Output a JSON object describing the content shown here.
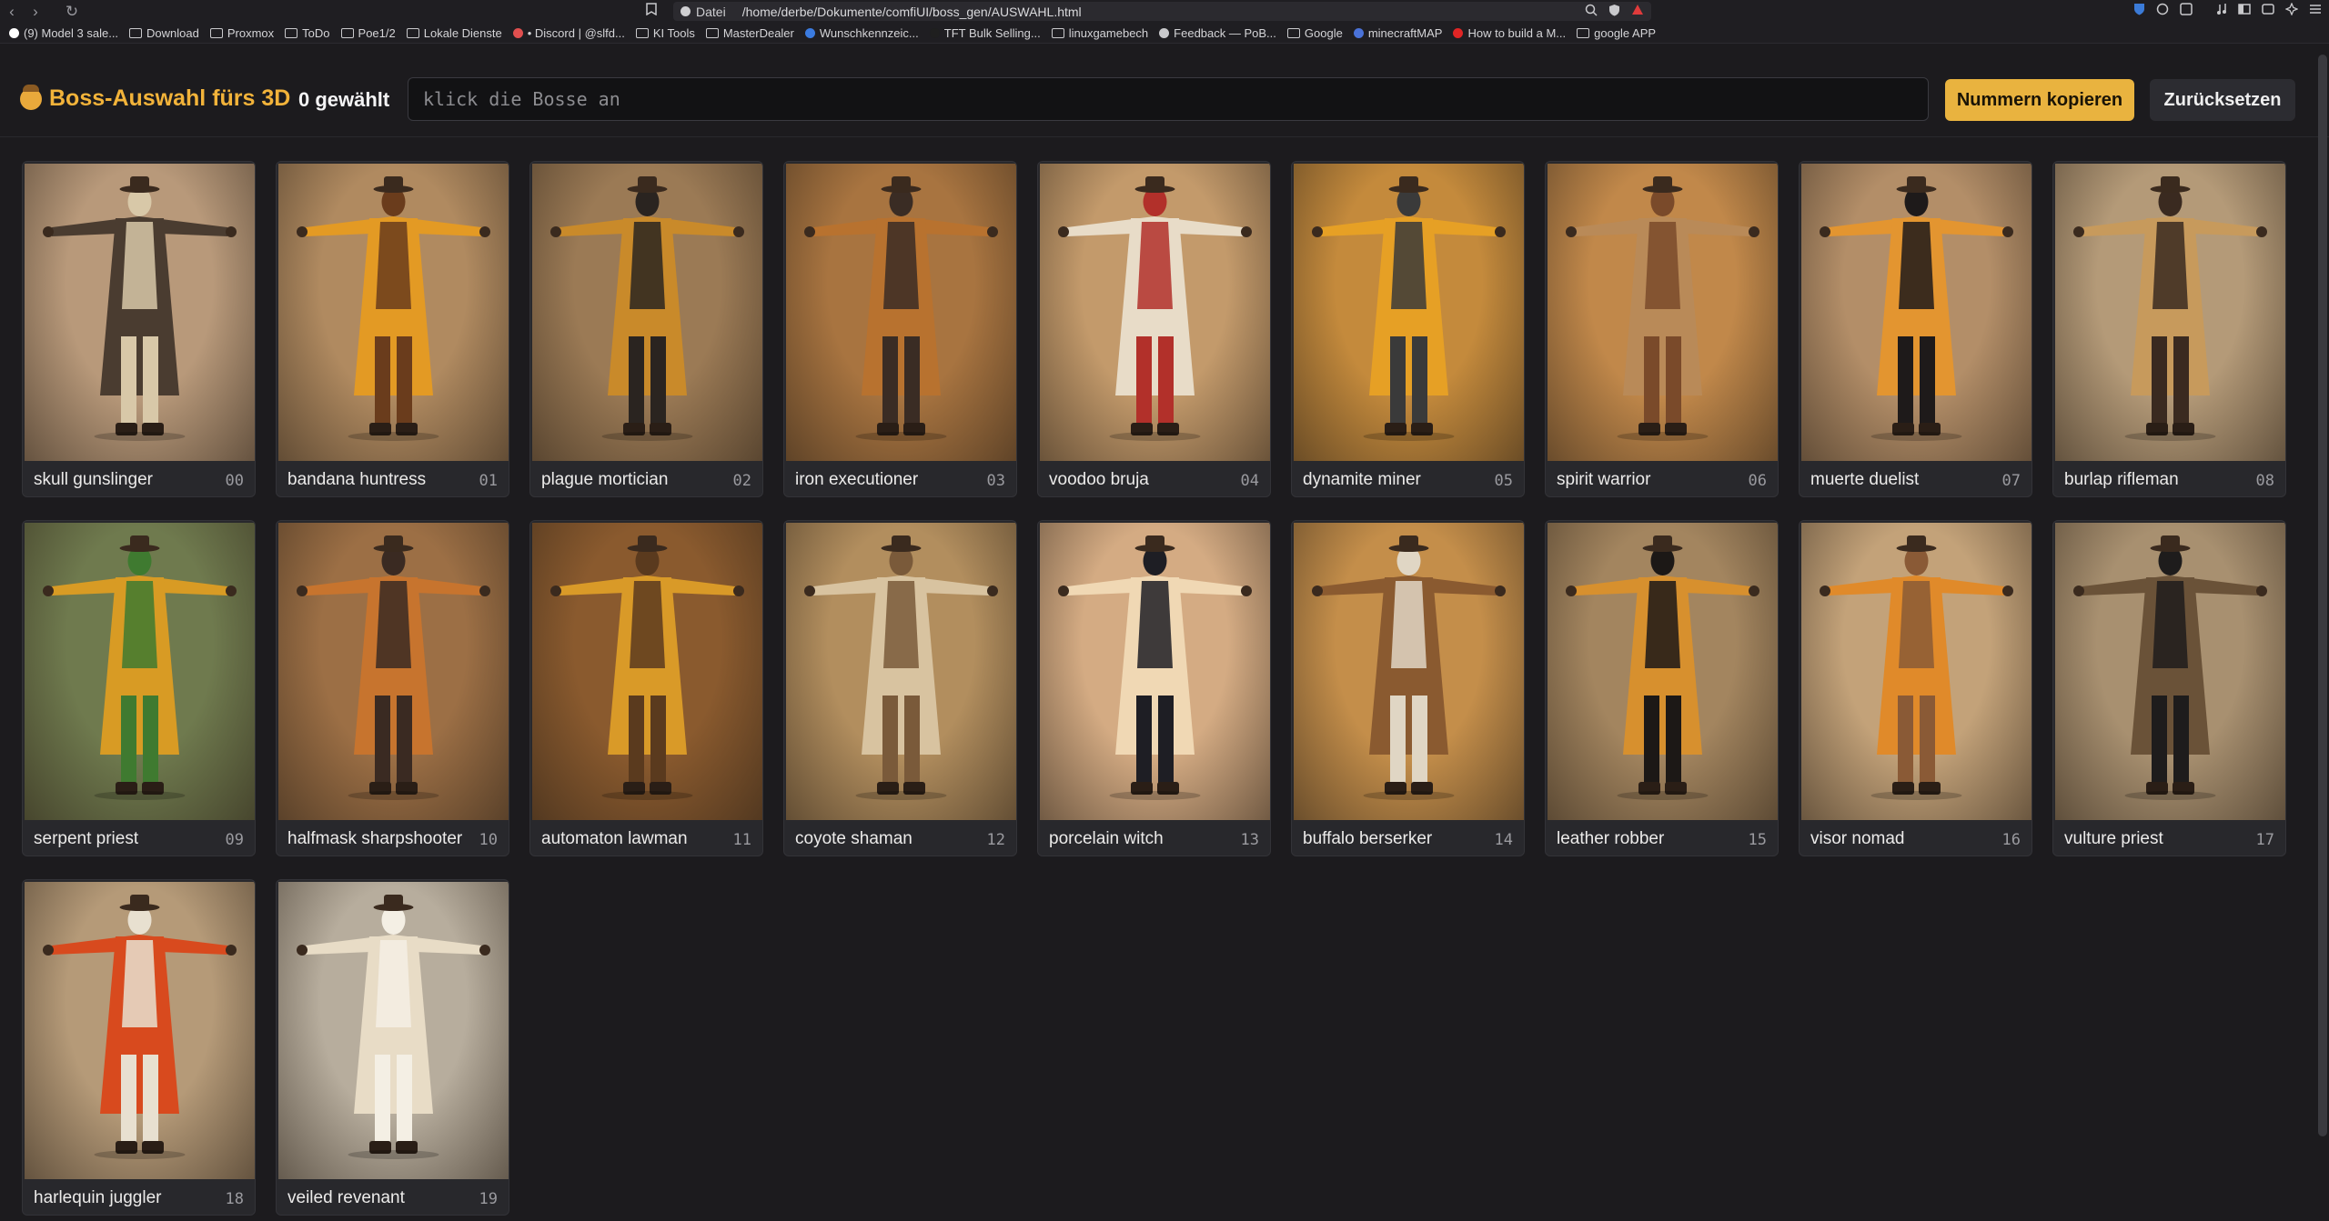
{
  "browser": {
    "nav": {
      "back": "‹",
      "forward": "›",
      "reload": "↻"
    },
    "url_scheme": "Datei",
    "url_path": "/home/derbe/Dokumente/comfiUI/boss_gen/AUSWAHL.html",
    "bookmarks": [
      {
        "label": "(9) Model 3 sale...",
        "icon": "x-logo-icon",
        "color": "#ffffff"
      },
      {
        "label": "Download",
        "icon": "folder-icon"
      },
      {
        "label": "Proxmox",
        "icon": "folder-icon"
      },
      {
        "label": "ToDo",
        "icon": "folder-icon"
      },
      {
        "label": "Poe1/2",
        "icon": "folder-icon"
      },
      {
        "label": "Lokale Dienste",
        "icon": "folder-icon"
      },
      {
        "label": "• Discord | @slfd...",
        "icon": "discord-icon",
        "color": "#e04f4f"
      },
      {
        "label": "KI Tools",
        "icon": "folder-icon"
      },
      {
        "label": "MasterDealer",
        "icon": "folder-icon"
      },
      {
        "label": "Wunschkennzeic...",
        "icon": "site-icon",
        "color": "#3b7be0"
      },
      {
        "label": "TFT Bulk Selling...",
        "icon": "site-icon",
        "color": "#1f1f1f"
      },
      {
        "label": "linuxgamebech",
        "icon": "folder-icon"
      },
      {
        "label": "Feedback — PoB...",
        "icon": "globe-icon",
        "color": "#c9c9cc"
      },
      {
        "label": "Google",
        "icon": "folder-icon"
      },
      {
        "label": "minecraftMAP",
        "icon": "site-icon",
        "color": "#4a72d8"
      },
      {
        "label": "How to build a M...",
        "icon": "youtube-icon",
        "color": "#e02525"
      },
      {
        "label": "google APP",
        "icon": "folder-icon"
      }
    ]
  },
  "app": {
    "title": "Boss-Auswahl fürs 3D",
    "count_label": "0 gewählt",
    "search_placeholder": "klick die Bosse an",
    "copy_label": "Nummern kopieren",
    "reset_label": "Zurücksetzen",
    "accent": "#e9b33f"
  },
  "bosses": [
    {
      "name": "skull gunslinger",
      "num": "00",
      "bg": "#b8997a",
      "coat": "#4a3c30",
      "accent": "#d8c8a8"
    },
    {
      "name": "bandana huntress",
      "num": "01",
      "bg": "#b08a60",
      "coat": "#e39a24",
      "accent": "#6a3c1c"
    },
    {
      "name": "plague mortician",
      "num": "02",
      "bg": "#9b7a55",
      "coat": "#c98a2a",
      "accent": "#2a2420"
    },
    {
      "name": "iron executioner",
      "num": "03",
      "bg": "#a87440",
      "coat": "#b8722f",
      "accent": "#3a2c24"
    },
    {
      "name": "voodoo bruja",
      "num": "04",
      "bg": "#c39a6b",
      "coat": "#e8dcc8",
      "accent": "#b2302a"
    },
    {
      "name": "dynamite miner",
      "num": "05",
      "bg": "#c48a3c",
      "coat": "#e6a025",
      "accent": "#3a3a3a"
    },
    {
      "name": "spirit warrior",
      "num": "06",
      "bg": "#c1884a",
      "coat": "#b98a58",
      "accent": "#7a4a2a"
    },
    {
      "name": "muerte duelist",
      "num": "07",
      "bg": "#b38e68",
      "coat": "#e39530",
      "accent": "#1e1a1a"
    },
    {
      "name": "burlap rifleman",
      "num": "08",
      "bg": "#b49a78",
      "coat": "#c79a5c",
      "accent": "#3a2a20"
    },
    {
      "name": "serpent priest",
      "num": "09",
      "bg": "#6f7a4e",
      "coat": "#d89b24",
      "accent": "#3f7a30"
    },
    {
      "name": "halfmask sharpshooter",
      "num": "10",
      "bg": "#9c6f45",
      "coat": "#c7742e",
      "accent": "#3a2a22"
    },
    {
      "name": "automaton lawman",
      "num": "11",
      "bg": "#8a5a2e",
      "coat": "#d99a28",
      "accent": "#5a3a1e"
    },
    {
      "name": "coyote shaman",
      "num": "12",
      "bg": "#b28e5e",
      "coat": "#d8c3a0",
      "accent": "#7a5a3a"
    },
    {
      "name": "porcelain witch",
      "num": "13",
      "bg": "#d4ab83",
      "coat": "#f0d8b4",
      "accent": "#1e1e24"
    },
    {
      "name": "buffalo berserker",
      "num": "14",
      "bg": "#c48e4a",
      "coat": "#8a5a30",
      "accent": "#e0d6c4"
    },
    {
      "name": "leather robber",
      "num": "15",
      "bg": "#a3855f",
      "coat": "#d7902e",
      "accent": "#1c1816"
    },
    {
      "name": "visor nomad",
      "num": "16",
      "bg": "#c3a279",
      "coat": "#e08a2a",
      "accent": "#8a5a36"
    },
    {
      "name": "vulture priest",
      "num": "17",
      "bg": "#a89070",
      "coat": "#6a5238",
      "accent": "#1e1c1c"
    },
    {
      "name": "harlequin juggler",
      "num": "18",
      "bg": "#b59a78",
      "coat": "#d84a1e",
      "accent": "#e8e0d0"
    },
    {
      "name": "veiled revenant",
      "num": "19",
      "bg": "#b7ad9d",
      "coat": "#e8dcc6",
      "accent": "#f4efe4"
    }
  ]
}
